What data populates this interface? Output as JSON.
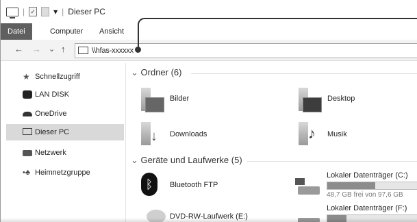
{
  "title": {
    "quick_access_separator": "|",
    "dropdown": "▾",
    "window_title": "Dieser PC"
  },
  "ribbon": {
    "tabs": [
      {
        "label": "Datei",
        "active": true
      },
      {
        "label": "Computer",
        "active": false
      },
      {
        "label": "Ansicht",
        "active": false
      }
    ]
  },
  "nav": {
    "back": "←",
    "forward": "→",
    "recent": "⌄",
    "up": "↑",
    "address": "\\\\hfas-xxxxxx"
  },
  "sidebar": {
    "items": [
      {
        "label": "Schnellzugriff",
        "icon": "star-icon",
        "selected": false
      },
      {
        "label": "LAN DISK",
        "icon": "lan-disk-icon",
        "selected": false
      },
      {
        "label": "OneDrive",
        "icon": "cloud-icon",
        "selected": false
      },
      {
        "label": "Dieser PC",
        "icon": "computer-icon",
        "selected": true
      },
      {
        "label": "Netzwerk",
        "icon": "network-icon",
        "selected": false
      },
      {
        "label": "Heimnetzgruppe",
        "icon": "homegroup-icon",
        "selected": false
      }
    ]
  },
  "main": {
    "folders_header": "Ordner (6)",
    "folders": [
      {
        "label": "Bilder",
        "icon": "pictures-folder-icon"
      },
      {
        "label": "Desktop",
        "icon": "desktop-folder-icon"
      },
      {
        "label": "Downloads",
        "icon": "downloads-folder-icon"
      },
      {
        "label": "Musik",
        "icon": "music-folder-icon"
      }
    ],
    "devices_header": "Geräte und Laufwerke (5)",
    "devices": [
      {
        "label": "Bluetooth FTP",
        "icon": "bluetooth-icon"
      },
      {
        "label": "Lokaler Datenträger (C:)",
        "icon": "windows-drive-icon",
        "free": "48,7 GB frei von 97,6 GB",
        "used_fraction": 0.5
      },
      {
        "label": "DVD-RW-Laufwerk (E:)",
        "icon": "dvd-drive-icon"
      },
      {
        "label": "Lokaler Datenträger (F:)",
        "icon": "drive-icon",
        "used_fraction": 0.2
      }
    ]
  }
}
